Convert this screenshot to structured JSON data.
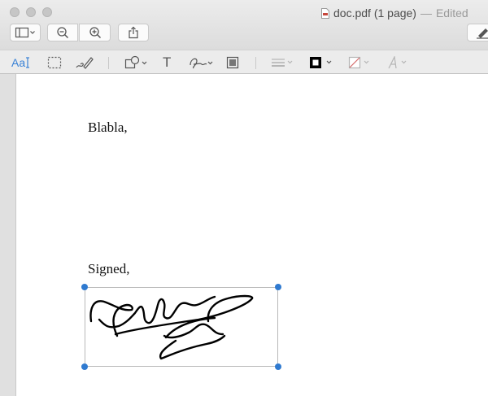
{
  "window": {
    "title": "doc.pdf (1 page)",
    "separator": "—",
    "status": "Edited"
  },
  "toolbar": {
    "buttons": [
      "sidebar-toggle",
      "zoom-out",
      "zoom-in",
      "share",
      "markup-toggle"
    ]
  },
  "markup_toolbar": {
    "text_style_label": "Aa",
    "text_tool_label": "T",
    "tools": [
      "text-selection",
      "rectangular-selection",
      "sketch",
      "shapes",
      "text",
      "sign",
      "note",
      "shape-style",
      "border-color",
      "fill-color",
      "text-style"
    ]
  },
  "document": {
    "line1": "Blabla,",
    "line2": "Signed,"
  },
  "colors": {
    "accent": "#2f7ad0",
    "toolbar_bg": "#ececec",
    "page_bg": "#ffffff"
  }
}
